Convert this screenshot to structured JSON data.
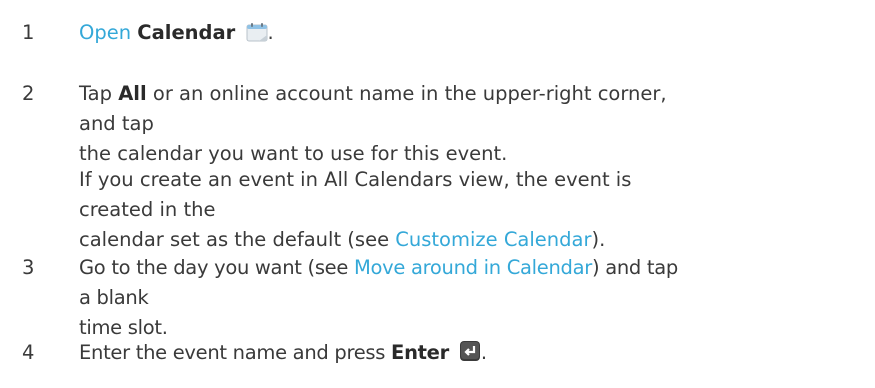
{
  "steps": [
    {
      "number": "1",
      "link": "Open",
      "bold": "Calendar",
      "icon": "calendar-app-icon",
      "tail": "."
    },
    {
      "number": "2",
      "pre": "Tap ",
      "bold": "All",
      "line1_rest": " or an online account name in the upper-right corner, and tap",
      "line2": "the calendar you want to use for this event.",
      "note_line1": "If you create an event in All Calendars view, the event is created in the",
      "note_line2_pre": "calendar set as the default (see ",
      "note_link": "Customize Calendar",
      "note_line2_post": ")."
    },
    {
      "number": "3",
      "pre": "Go to the day you want (see ",
      "link": "Move around in Calendar",
      "post": ") and tap a blank",
      "line2": "time slot."
    },
    {
      "number": "4",
      "pre": "Enter the event name and press ",
      "bold": "Enter",
      "icon": "enter-key-icon",
      "tail": "."
    }
  ],
  "colors": {
    "text": "#3a3a3a",
    "link": "#34a8d8"
  }
}
